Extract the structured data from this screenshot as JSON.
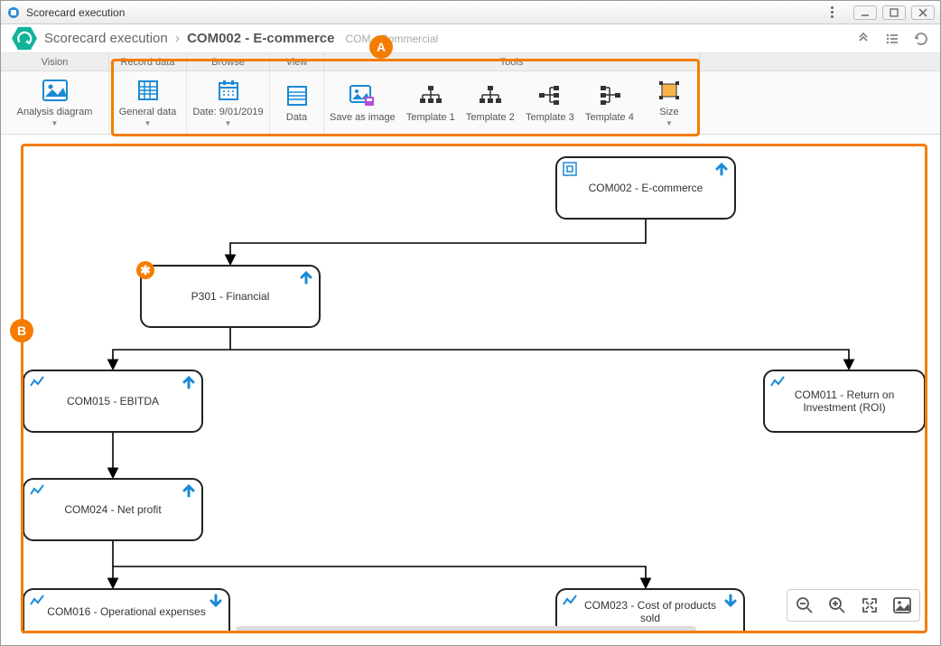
{
  "window": {
    "title": "Scorecard execution"
  },
  "breadcrumb": {
    "root": "Scorecard execution",
    "current": "COM002 - E-commerce",
    "meta": "COM - Commercial"
  },
  "ribbon_tabs": {
    "vision": "Vision",
    "record_data": "Record data",
    "browse": "Browse",
    "view": "View",
    "tools": "Tools"
  },
  "ribbon": {
    "analysis_diagram": "Analysis diagram",
    "general_data": "General data",
    "date": "Date: 9/01/2019",
    "data": "Data",
    "save_as_image": "Save as image",
    "template1": "Template 1",
    "template2": "Template 2",
    "template3": "Template 3",
    "template4": "Template 4",
    "size": "Size"
  },
  "callouts": {
    "a": "A",
    "b": "B"
  },
  "nodes": {
    "root": "COM002 - E-commerce",
    "financial": "P301 - Financial",
    "ebitda": "COM015 - EBITDA",
    "roi": "COM011 - Return on Investment (ROI)",
    "netprofit": "COM024 - Net profit",
    "opex": "COM016 - Operational expenses",
    "cogs": "COM023 - Cost of products sold"
  }
}
